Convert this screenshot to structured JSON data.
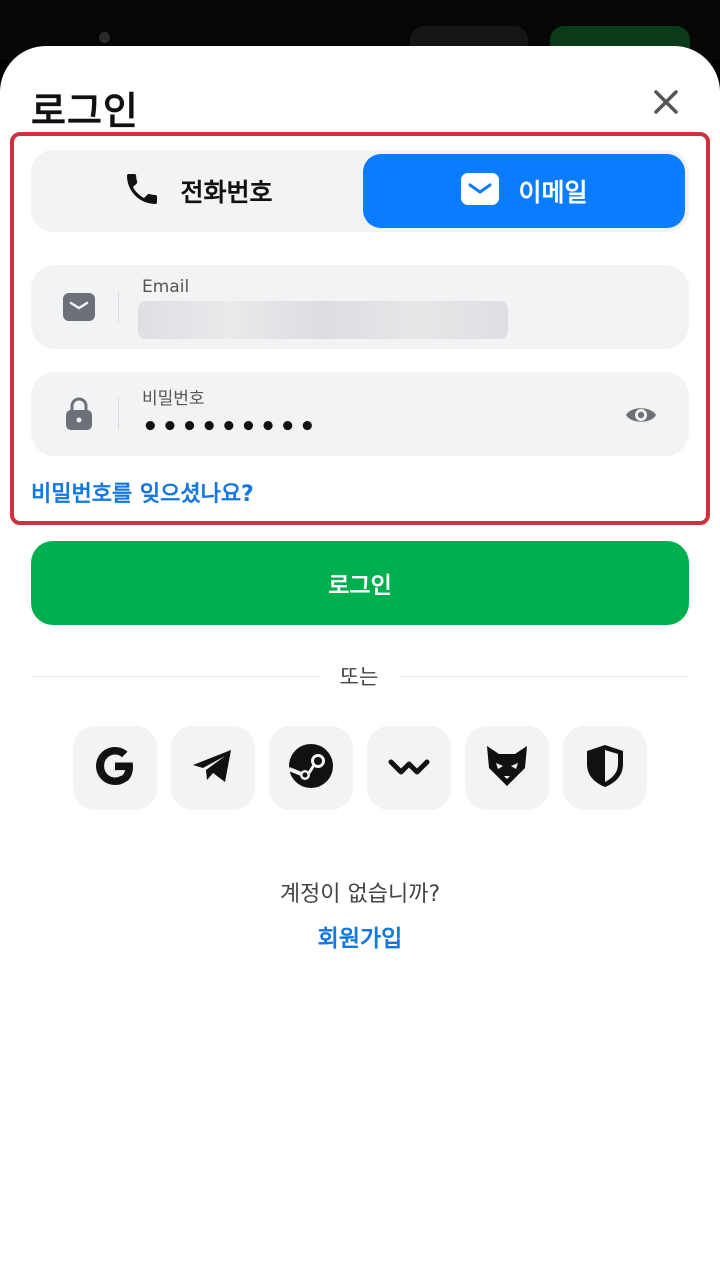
{
  "header": {
    "title": "로그인"
  },
  "login_method_tabs": [
    {
      "label": "전화번호",
      "icon": "phone-icon",
      "selected": false
    },
    {
      "label": "이메일",
      "icon": "mail-icon",
      "selected": true
    }
  ],
  "email_field": {
    "label": "Email",
    "value_obscured": true
  },
  "password_field": {
    "label": "비밀번호",
    "value": "•••••••••"
  },
  "forgot_password_link": "비밀번호를 잊으셨나요?",
  "login_button": "로그인",
  "divider_text": "또는",
  "social_logins": [
    {
      "icon": "google-icon"
    },
    {
      "icon": "telegram-icon"
    },
    {
      "icon": "steam-icon"
    },
    {
      "icon": "walletconnect-icon"
    },
    {
      "icon": "fox-wallet-icon"
    },
    {
      "icon": "shield-icon"
    }
  ],
  "footer": {
    "prompt": "계정이 없습니까?",
    "signup_link": "회원가입"
  },
  "colors": {
    "accent_blue": "#0a7cff",
    "link_blue": "#1577e0",
    "login_green": "#00b04f",
    "highlight_red": "#d2303e"
  }
}
